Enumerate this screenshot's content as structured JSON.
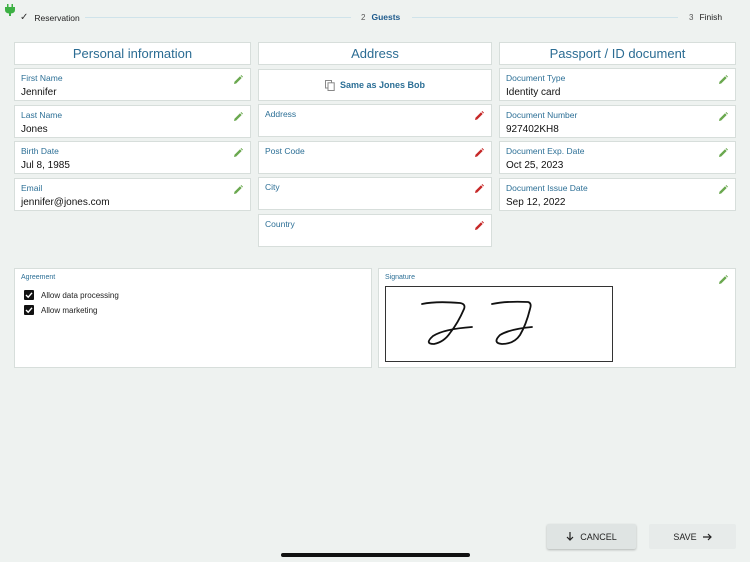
{
  "stepper": {
    "steps": [
      {
        "label": "Reservation",
        "state": "done"
      },
      {
        "number": "2",
        "label": "Guests",
        "state": "active"
      },
      {
        "number": "3",
        "label": "Finish",
        "state": "pending"
      }
    ]
  },
  "columns": {
    "personal": "Personal information",
    "address": "Address",
    "passport": "Passport / ID document"
  },
  "personal": {
    "first_name": {
      "label": "First Name",
      "value": "Jennifer"
    },
    "last_name": {
      "label": "Last Name",
      "value": "Jones"
    },
    "birth_date": {
      "label": "Birth Date",
      "value": "Jul 8, 1985"
    },
    "email": {
      "label": "Email",
      "value": "jennifer@jones.com"
    }
  },
  "address": {
    "same_as": "Same as Jones Bob",
    "address": {
      "label": "Address",
      "value": ""
    },
    "post_code": {
      "label": "Post Code",
      "value": ""
    },
    "city": {
      "label": "City",
      "value": ""
    },
    "country": {
      "label": "Country",
      "value": ""
    }
  },
  "passport": {
    "doc_type": {
      "label": "Document Type",
      "value": "Identity card"
    },
    "doc_number": {
      "label": "Document Number",
      "value": "927402KH8"
    },
    "doc_exp": {
      "label": "Document Exp. Date",
      "value": "Oct 25, 2023"
    },
    "doc_issue": {
      "label": "Document Issue Date",
      "value": "Sep 12, 2022"
    }
  },
  "agreement": {
    "title": "Agreement",
    "items": [
      {
        "label": "Allow data processing",
        "checked": true
      },
      {
        "label": "Allow marketing",
        "checked": true
      }
    ]
  },
  "signature": {
    "title": "Signature"
  },
  "buttons": {
    "cancel": "CANCEL",
    "save": "SAVE"
  },
  "colors": {
    "accent": "#2c6f96",
    "edit_green": "#6aa84f",
    "edit_red": "#c62828"
  }
}
